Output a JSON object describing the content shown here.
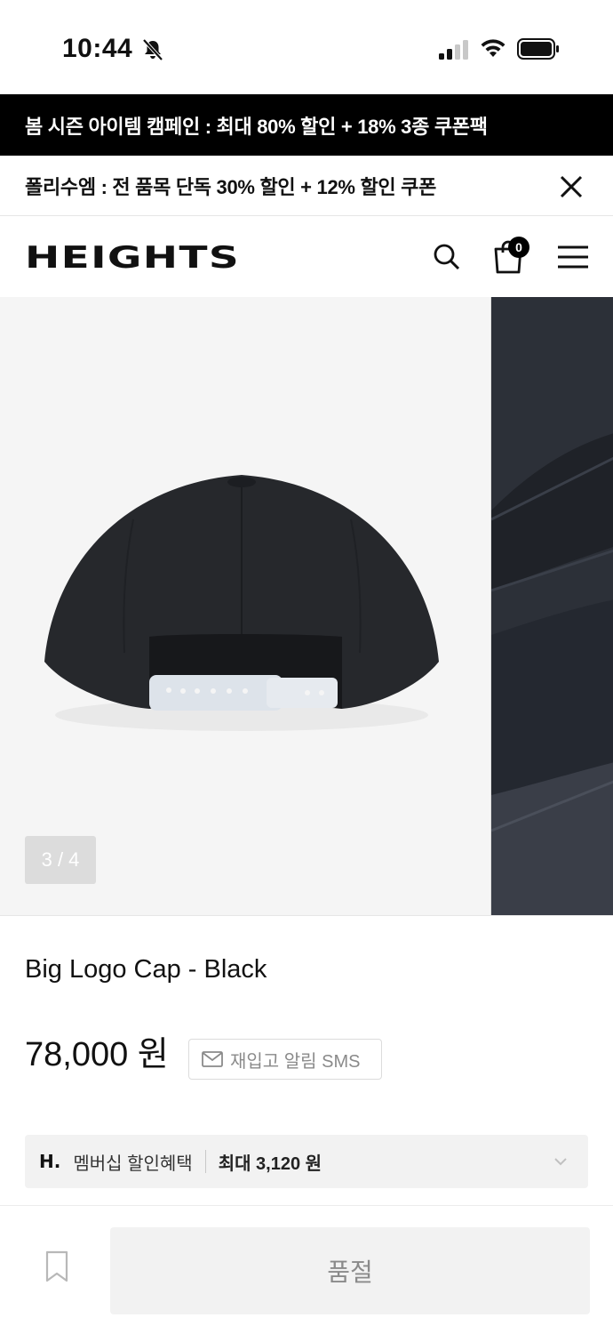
{
  "status_bar": {
    "time": "10:44"
  },
  "promo": {
    "banner_1": "봄 시즌 아이템 캠페인 : 최대 80% 할인 + 18% 3종 쿠폰팩",
    "banner_2": "폴리수엠 : 전 품목 단독 30% 할인 + 12% 할인 쿠폰"
  },
  "header": {
    "logo": "HEIGHTS",
    "cart_count": "0"
  },
  "gallery": {
    "counter": "3 / 4"
  },
  "product": {
    "name": "Big Logo Cap - Black",
    "price": "78,000 원",
    "restock_label": "재입고 알림 SMS"
  },
  "membership": {
    "logo": "H.",
    "label": "멤버십 할인혜택",
    "max_label": "최대 3,120 원"
  },
  "bottom": {
    "soldout_label": "품절"
  },
  "colors": {
    "banner_bg": "#000000",
    "cap": "#26282c",
    "strap": "#dde3ea",
    "button_bg": "#f2f2f2"
  }
}
